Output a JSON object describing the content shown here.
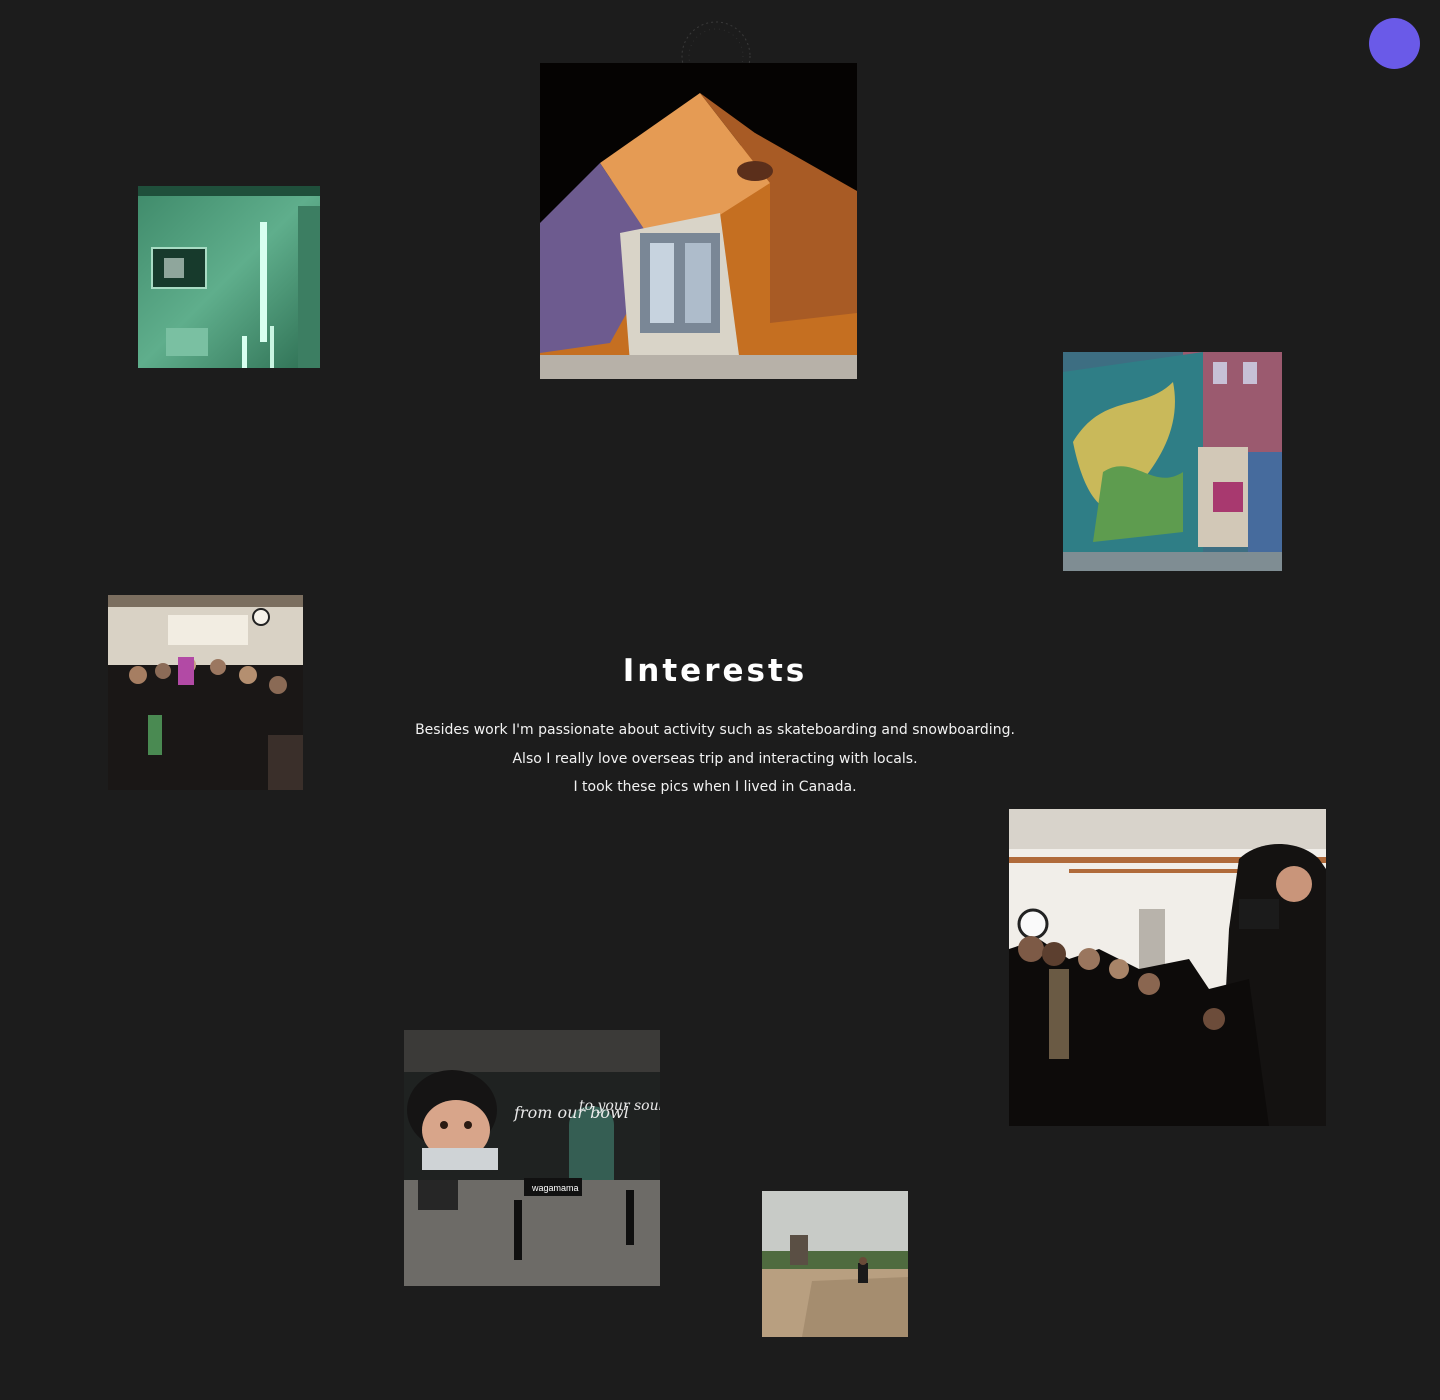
{
  "colors": {
    "background": "#1c1c1c",
    "accent": "#6a5ae8",
    "text": "#ffffff"
  },
  "logo": {
    "icon": "circular-text-logo"
  },
  "fab": {
    "icon": "circle-button"
  },
  "section": {
    "title": "Interests",
    "lines": [
      "Besides work I'm passionate about activity such as skateboarding and snowboarding.",
      "Also I really love overseas trip and interacting with locals.",
      "I took these pics when I lived in Canada."
    ]
  },
  "photos": {
    "wagamama_mural": {
      "sign_text": "wagamama",
      "mural_text_1": "from our bowl",
      "mural_text_2": "to your soul"
    }
  }
}
